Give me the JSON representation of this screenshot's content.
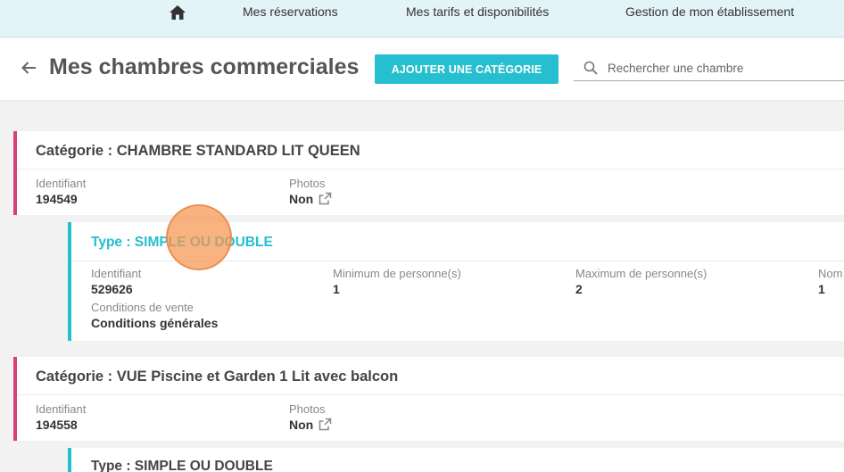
{
  "nav": {
    "items": [
      "Mes réservations",
      "Mes tarifs et disponibilités",
      "Gestion de mon établissement"
    ]
  },
  "header": {
    "title": "Mes chambres commerciales",
    "add_button": "AJOUTER UNE CATÉGORIE",
    "search_placeholder": "Rechercher une chambre"
  },
  "categories": [
    {
      "title": "Catégorie : CHAMBRE STANDARD LIT QUEEN",
      "id_label": "Identifiant",
      "id": "194549",
      "photos_label": "Photos",
      "photos": "Non",
      "types": [
        {
          "title": "Type : SIMPLE OU DOUBLE",
          "id_label": "Identifiant",
          "id": "529626",
          "min_label": "Minimum de personne(s)",
          "min": "1",
          "max_label": "Maximum de personne(s)",
          "max": "2",
          "extra_label": "Nom",
          "extra": "1",
          "cond_label": "Conditions de vente",
          "cond": "Conditions générales"
        }
      ]
    },
    {
      "title": "Catégorie : VUE Piscine et Garden 1 Lit avec balcon",
      "id_label": "Identifiant",
      "id": "194558",
      "photos_label": "Photos",
      "photos": "Non",
      "types": [
        {
          "title": "Type : SIMPLE OU DOUBLE"
        }
      ]
    }
  ],
  "colors": {
    "accent": "#25bfcf",
    "category_border": "#d6407d",
    "topnav_bg": "#e3f4f8"
  },
  "icons": [
    "home-icon",
    "back-arrow-icon",
    "search-icon",
    "external-link-icon"
  ]
}
